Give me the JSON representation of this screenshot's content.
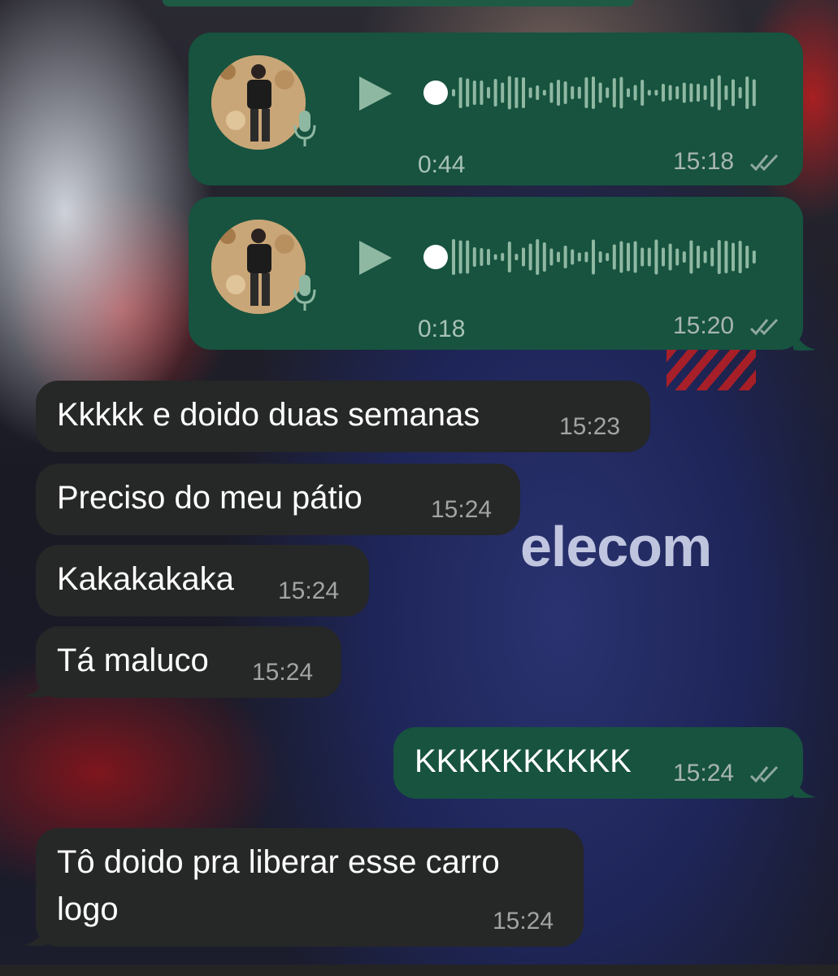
{
  "voice_messages": [
    {
      "duration": "0:44",
      "time": "15:18"
    },
    {
      "duration": "0:18",
      "time": "15:20"
    }
  ],
  "messages": [
    {
      "direction": "in",
      "text": "Kkkkk e doido duas semanas",
      "time": "15:23"
    },
    {
      "direction": "in",
      "text": "Preciso do meu pátio",
      "time": "15:24"
    },
    {
      "direction": "in",
      "text": "Kakakakaka",
      "time": "15:24"
    },
    {
      "direction": "in",
      "text": "Tá maluco",
      "time": "15:24"
    },
    {
      "direction": "out",
      "text": "KKKKKKKKKK",
      "time": "15:24"
    },
    {
      "direction": "in",
      "text_line1": "Tô doido pra liberar esse carro",
      "text_line2": "logo",
      "time": "15:24"
    }
  ],
  "colors": {
    "incoming_bubble": "#262727",
    "outgoing_bubble": "#17533f",
    "read_ticks": "#8fa8a0"
  },
  "icons": [
    "play-icon",
    "mic-icon",
    "double-check-icon",
    "avatar"
  ]
}
